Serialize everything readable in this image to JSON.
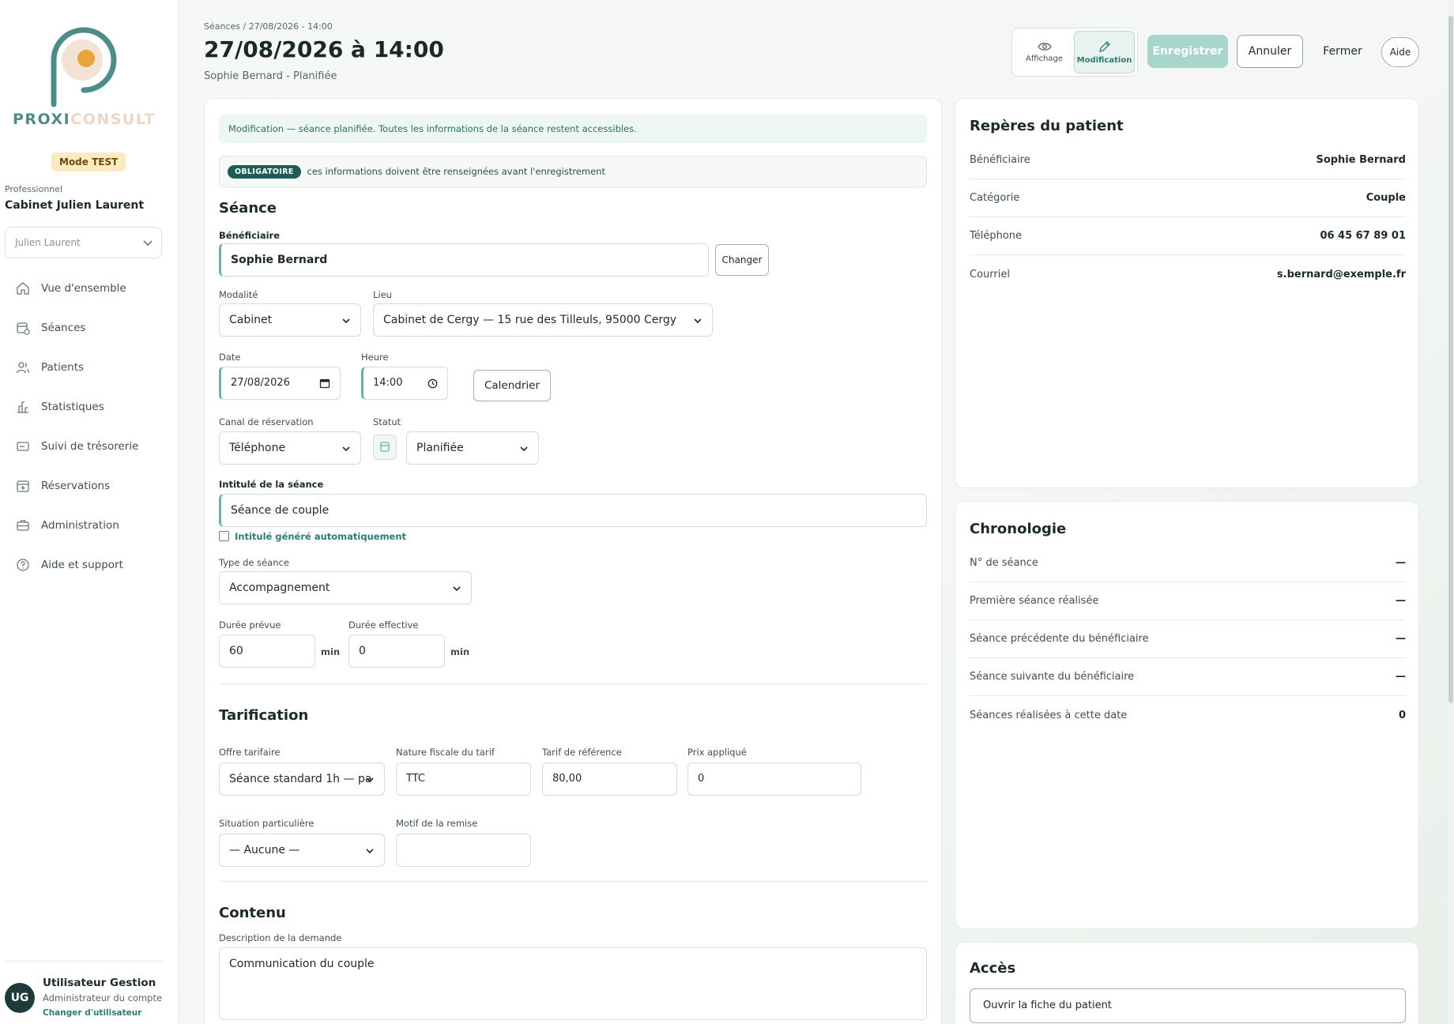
{
  "brand": {
    "name_part1": "PROXI",
    "name_part2": "CONSULT",
    "primary": "#4e8d87",
    "accent": "#e8a33a"
  },
  "sidebar": {
    "mode_badge": "Mode TEST",
    "pro_label": "Professionnel",
    "pro_name": "Cabinet Julien Laurent",
    "pro_select": "Julien Laurent",
    "items": [
      {
        "label": "Vue d'ensemble",
        "icon": "home-icon"
      },
      {
        "label": "Séances",
        "icon": "calendar-clock-icon"
      },
      {
        "label": "Patients",
        "icon": "users-icon"
      },
      {
        "label": "Statistiques",
        "icon": "bar-chart-icon"
      },
      {
        "label": "Suivi de trésorerie",
        "icon": "wallet-icon"
      },
      {
        "label": "Réservations",
        "icon": "calendar-plus-icon"
      },
      {
        "label": "Administration",
        "icon": "briefcase-icon"
      },
      {
        "label": "Aide et support",
        "icon": "help-circle-icon"
      }
    ],
    "user": {
      "initials": "UG",
      "name": "Utilisateur Gestion",
      "role": "Administrateur du compte",
      "switch": "Changer d'utilisateur"
    }
  },
  "header": {
    "breadcrumb": "Séances / 27/08/2026 - 14:00",
    "title": "27/08/2026 à 14:00",
    "subtitle": "Sophie Bernard - Planifiée",
    "mode_view": "Affichage",
    "mode_edit": "Modification",
    "save": "Enregistrer",
    "cancel": "Annuler",
    "close": "Fermer",
    "help": "Aide"
  },
  "form": {
    "info": "Modification — séance planifiée. Toutes les informations de la séance restent accessibles.",
    "required_pill": "OBLIGATOIRE",
    "required_text": "ces informations doivent être renseignées avant l'enregistrement",
    "section_session": "Séance",
    "beneficiary_label": "Bénéficiaire",
    "beneficiary_value": "Sophie Bernard",
    "change_button": "Changer",
    "modality_label": "Modalité",
    "modality_value": "Cabinet",
    "place_label": "Lieu",
    "place_value": "Cabinet de Cergy — 15 rue des Tilleuls, 95000 Cergy",
    "date_label": "Date",
    "date_value": "27/08/2026",
    "time_label": "Heure",
    "time_value": "14:00",
    "calendar_button": "Calendrier",
    "channel_label": "Canal de réservation",
    "channel_value": "Téléphone",
    "status_label": "Statut",
    "status_value": "Planifiée",
    "title_label": "Intitulé de la séance",
    "title_value": "Séance de couple",
    "auto_title": "Intitulé généré automatiquement",
    "type_label": "Type de séance",
    "type_value": "Accompagnement",
    "planned_label": "Durée prévue",
    "planned_value": "60",
    "effective_label": "Durée effective",
    "effective_value": "0",
    "unit_min": "min",
    "section_pricing": "Tarification",
    "offer_label": "Offre tarifaire",
    "offer_value": "Séance standard 1h — pa",
    "tax_label": "Nature fiscale du tarif",
    "tax_value": "TTC",
    "ref_label": "Tarif de référence",
    "ref_value": "80,00",
    "price_label": "Prix appliqué",
    "price_value": "0",
    "situation_label": "Situation particulière",
    "situation_value": "— Aucune —",
    "discount_label": "Motif de la remise",
    "discount_value": "",
    "section_content": "Contenu",
    "desc_label": "Description de la demande",
    "desc_value": "Communication du couple"
  },
  "patient_card": {
    "title": "Repères du patient",
    "rows": [
      {
        "key": "Bénéficiaire",
        "value": "Sophie Bernard"
      },
      {
        "key": "Catégorie",
        "value": "Couple"
      },
      {
        "key": "Téléphone",
        "value": "06 45 67 89 01"
      },
      {
        "key": "Courriel",
        "value": "s.bernard@exemple.fr"
      }
    ]
  },
  "timeline_card": {
    "title": "Chronologie",
    "rows": [
      {
        "key": "N° de séance",
        "value": "—"
      },
      {
        "key": "Première séance réalisée",
        "value": "—"
      },
      {
        "key": "Séance précédente du bénéficiaire",
        "value": "—"
      },
      {
        "key": "Séance suivante du bénéficiaire",
        "value": "—"
      },
      {
        "key": "Séances réalisées à cette date",
        "value": "0"
      }
    ]
  },
  "access_card": {
    "title": "Accès",
    "open_patient": "Ouvrir la fiche du patient"
  }
}
